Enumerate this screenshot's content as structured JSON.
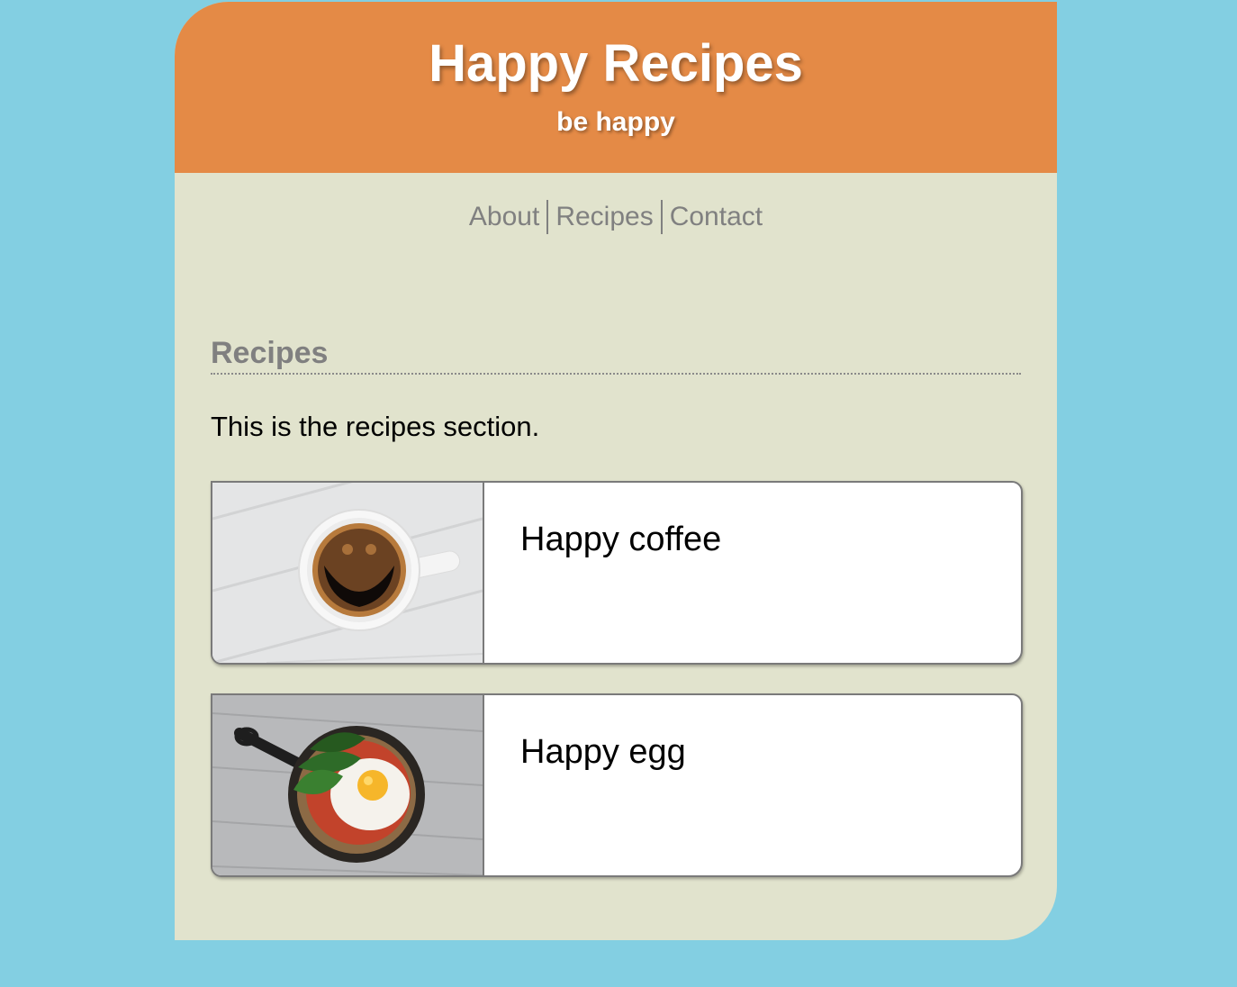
{
  "header": {
    "title": "Happy Recipes",
    "tagline": "be happy"
  },
  "nav": {
    "items": [
      {
        "label": "About"
      },
      {
        "label": "Recipes"
      },
      {
        "label": "Contact"
      }
    ]
  },
  "section": {
    "title": "Recipes",
    "intro": "This is the recipes section."
  },
  "recipes": [
    {
      "title": "Happy coffee",
      "image": "smiley-coffee-cup-photo"
    },
    {
      "title": "Happy egg",
      "image": "fried-egg-skillet-photo"
    }
  ],
  "colors": {
    "background": "#83cfe2",
    "header": "#e48a46",
    "page": "#e1e3cd",
    "nav_text": "#808080"
  }
}
